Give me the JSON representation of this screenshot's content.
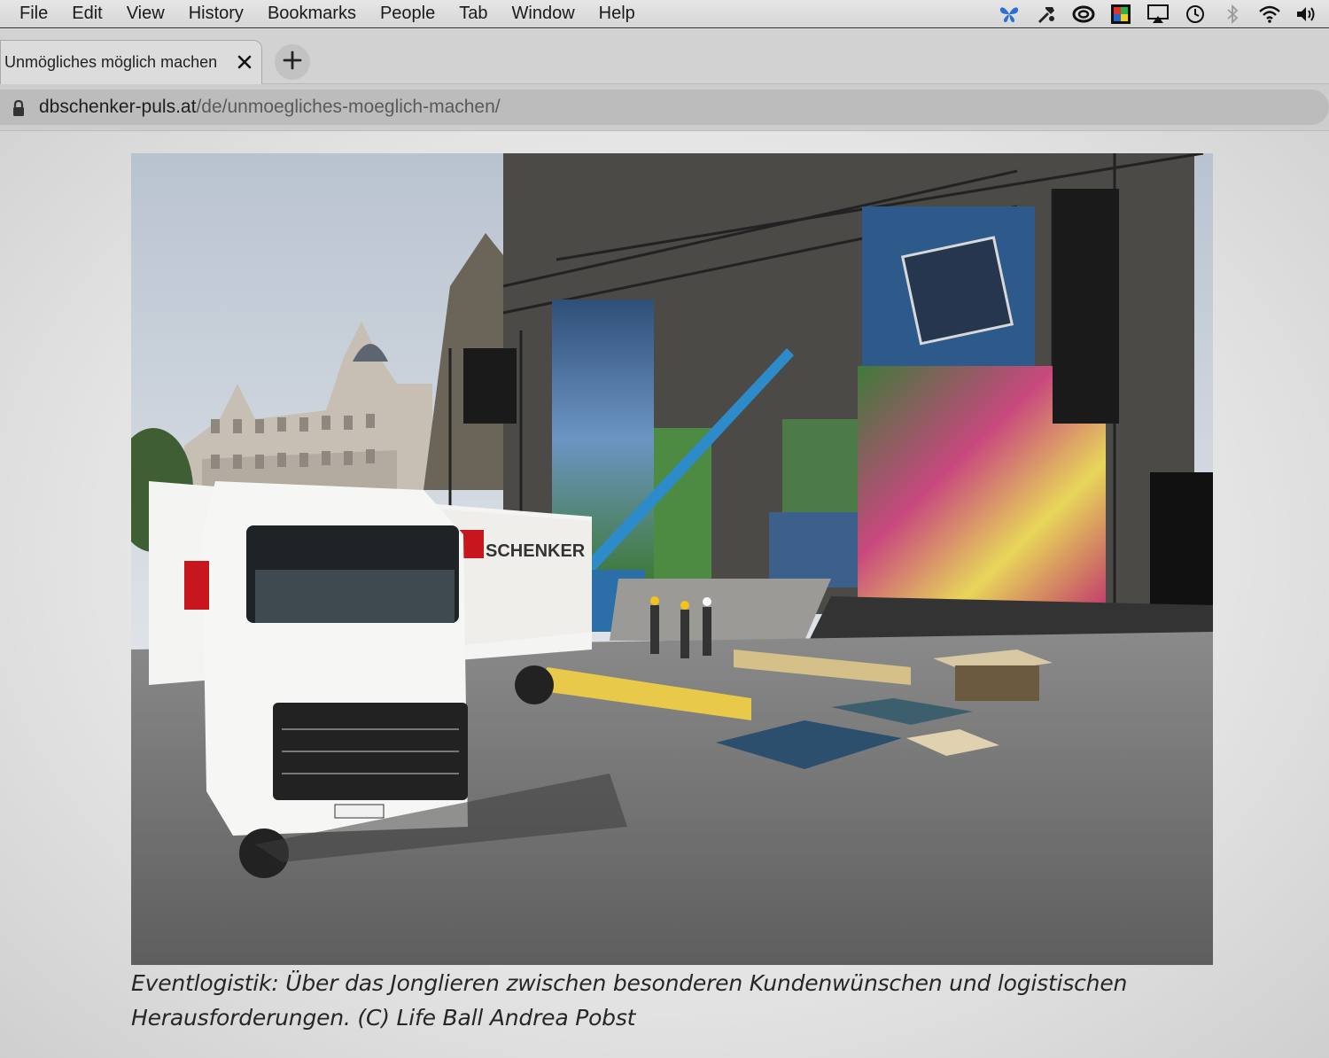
{
  "menubar": {
    "items": [
      "File",
      "Edit",
      "View",
      "History",
      "Bookmarks",
      "People",
      "Tab",
      "Window",
      "Help"
    ],
    "status_icons": [
      "butterfly-icon",
      "hammer-icon",
      "creative-cloud-icon",
      "color-app-icon",
      "airplay-icon",
      "time-machine-icon",
      "bluetooth-icon",
      "wifi-icon",
      "volume-icon"
    ]
  },
  "tab": {
    "title": "Unmögliches möglich machen",
    "close_icon": "close-icon",
    "new_tab_icon": "plus-icon"
  },
  "address": {
    "domain": "dbschenker-puls.at",
    "path": "/de/unmoegliches-moeglich-machen/",
    "lock_icon": "lock-icon"
  },
  "article": {
    "image_alt": "DB Schenker truck in front of the Life Ball stage at Vienna City Hall",
    "caption": "Eventlogistik: Über das Jonglieren zwischen besonderen Kundenwünschen und logistischen Herausforderungen. (C) Life Ball Andrea Pobst"
  },
  "colors": {
    "menubar_bg": "#dcdcdc",
    "tabstrip_bg": "#d2d2d2",
    "url_field_bg": "#bcbcbc",
    "page_bg": "#e4e4e4"
  }
}
